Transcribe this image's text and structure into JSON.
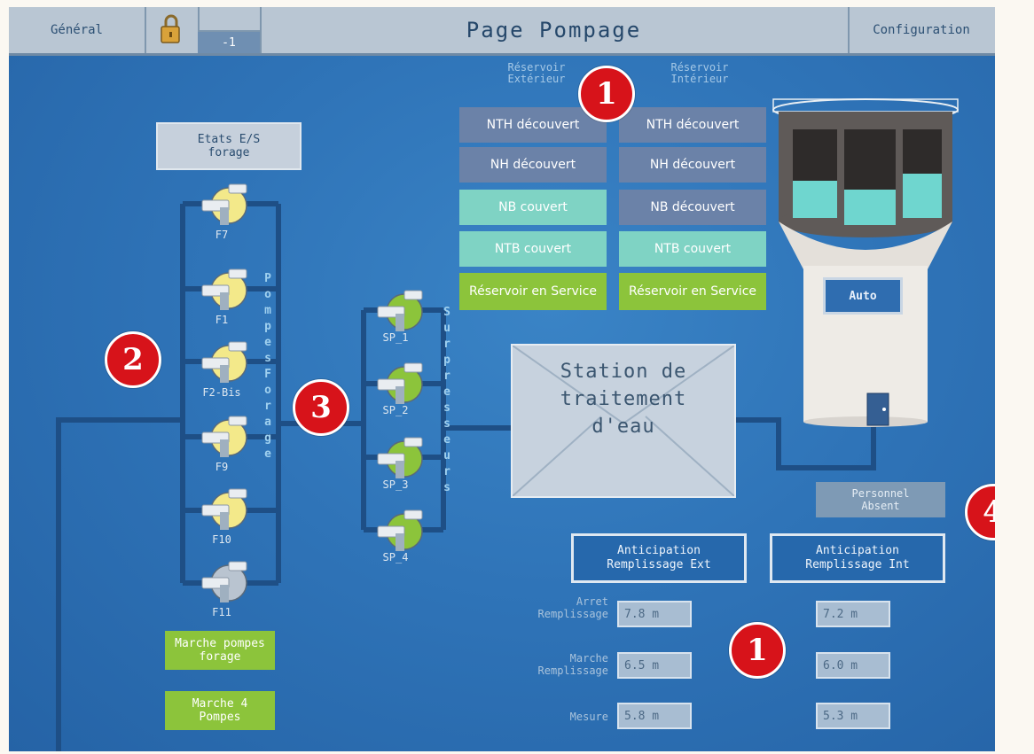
{
  "topbar": {
    "general": "Général",
    "level": "-1",
    "title": "Page Pompage",
    "configuration": "Configuration"
  },
  "reservoirs": {
    "ext_header": "Réservoir\nExtérieur",
    "int_header": "Réservoir\nIntérieur",
    "ext_states": [
      "NTH découvert",
      "NH découvert",
      "NB couvert",
      "NTB couvert",
      "Réservoir en Service"
    ],
    "int_states": [
      "NTH découvert",
      "NH découvert",
      "NB découvert",
      "NTB couvert",
      "Réservoir en Service"
    ]
  },
  "etats": "Etats E/S\nforage",
  "pompes_forage": {
    "group_label": "Pompes Forage",
    "pumps": [
      "F7",
      "F1",
      "F2-Bis",
      "F9",
      "F10",
      "F11"
    ]
  },
  "surpresseurs": {
    "group_label": "Surpresseurs",
    "pumps": [
      "SP_1",
      "SP_2",
      "SP_3",
      "SP_4"
    ]
  },
  "station": "Station de\ntraitement\nd'eau",
  "tower": {
    "auto_label": "Auto"
  },
  "personnel": "Personnel\nAbsent",
  "anticipation": {
    "ext": "Anticipation\nRemplissage Ext",
    "int": "Anticipation\nRemplissage Int"
  },
  "measures": {
    "rows": [
      {
        "label": "Arret\nRemplissage",
        "ext": "7.8  m",
        "int": "7.2  m"
      },
      {
        "label": "Marche\nRemplissage",
        "ext": "6.5  m",
        "int": "6.0  m"
      },
      {
        "label": "Mesure",
        "ext": "5.8  m",
        "int": "5.3  m"
      }
    ]
  },
  "buttons": {
    "marche_pompes_forage": "Marche pompes\nforage",
    "marche_4_pompes": "Marche 4\nPompes"
  },
  "badges": [
    "1",
    "2",
    "3",
    "4",
    "1"
  ],
  "colors": {
    "screen_blue": "#2f74b8",
    "pipe": "#1e4f86",
    "state_grey": "#6b82a8",
    "state_teal": "#7fd3c4",
    "state_green": "#8cc43b",
    "badge_red": "#d7131a",
    "pump_yellow": "#f3e98a",
    "pump_green": "#8cc43b"
  }
}
